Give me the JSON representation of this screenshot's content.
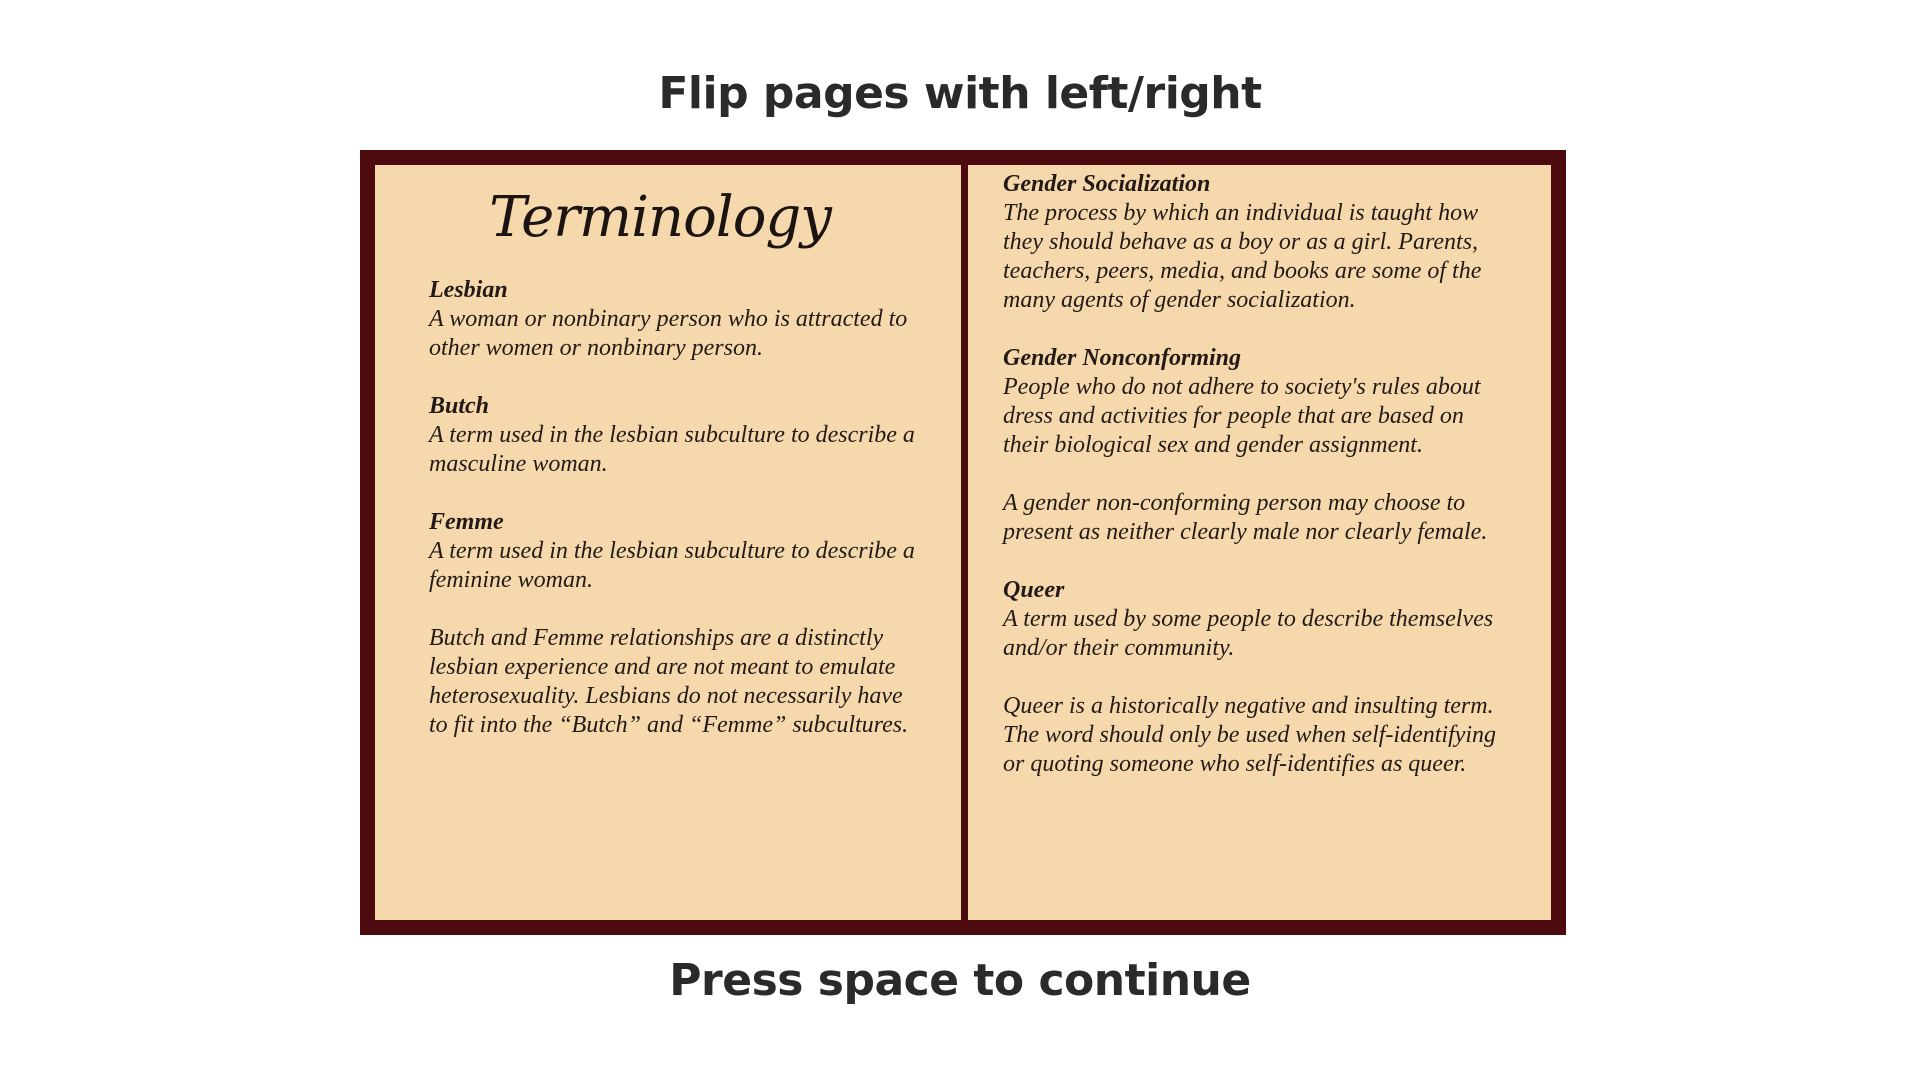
{
  "instructions": {
    "top": "Flip pages with left/right",
    "bottom": "Press space to continue"
  },
  "book": {
    "left_page": {
      "title": "Terminology",
      "entries": [
        {
          "term": "Lesbian",
          "definition": "A woman or nonbinary person who is attracted to other women or nonbinary person."
        },
        {
          "term": "Butch",
          "definition": "A term used in the lesbian subculture to describe a masculine woman."
        },
        {
          "term": "Femme",
          "definition": "A term used in the lesbian subculture to describe a feminine woman."
        },
        {
          "term": "",
          "definition": "Butch and Femme relationships are a distinctly lesbian experience and are not meant to emulate heterosexuality. Lesbians do not necessarily have to fit into the “Butch” and “Femme” subcultures."
        }
      ]
    },
    "right_page": {
      "entries": [
        {
          "term": "Gender Socialization",
          "definition": "The process by which an individual is taught how they should behave as a boy or as a girl. Parents, teachers, peers, media, and books are some of the many agents of gender socialization."
        },
        {
          "term": "Gender Nonconforming",
          "definition": "People who do not adhere to society's rules about dress and activities for people that are based on their biological sex and gender assignment."
        },
        {
          "term": "",
          "definition": "A gender non-conforming person may choose to present as neither clearly male nor clearly female."
        },
        {
          "term": "Queer",
          "definition": "A term used by some people to describe themselves and/or their community."
        },
        {
          "term": "",
          "definition": "Queer is a historically negative and insulting term. The word should only be used when self-identifying or quoting someone who self-identifies as queer."
        }
      ]
    }
  },
  "colors": {
    "book_cover": "#4d0a0f",
    "page": "#f5d8ac",
    "text": "#231a17"
  }
}
